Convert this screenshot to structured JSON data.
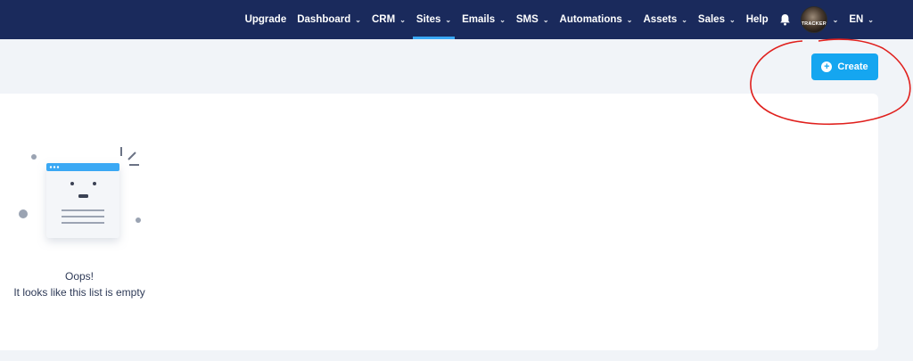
{
  "nav": {
    "items": [
      {
        "label": "Upgrade",
        "has_dropdown": false,
        "active": false
      },
      {
        "label": "Dashboard",
        "has_dropdown": true,
        "active": false
      },
      {
        "label": "CRM",
        "has_dropdown": true,
        "active": false
      },
      {
        "label": "Sites",
        "has_dropdown": true,
        "active": true
      },
      {
        "label": "Emails",
        "has_dropdown": true,
        "active": false
      },
      {
        "label": "SMS",
        "has_dropdown": true,
        "active": false
      },
      {
        "label": "Automations",
        "has_dropdown": true,
        "active": false
      },
      {
        "label": "Assets",
        "has_dropdown": true,
        "active": false
      },
      {
        "label": "Sales",
        "has_dropdown": true,
        "active": false
      },
      {
        "label": "Help",
        "has_dropdown": false,
        "active": false
      }
    ],
    "notification_icon": "bell-icon",
    "avatar_text": "TRACKER",
    "language": "EN"
  },
  "toolbar": {
    "create_label": "Create",
    "create_icon": "plus-circle-icon"
  },
  "empty_state": {
    "title": "Oops!",
    "message": "It looks like this list is empty"
  },
  "colors": {
    "nav_bg": "#1a2a5c",
    "accent": "#15a6f0",
    "active_underline": "#3aa8f4",
    "page_bg": "#f1f4f8",
    "annotation": "#e0201d"
  }
}
